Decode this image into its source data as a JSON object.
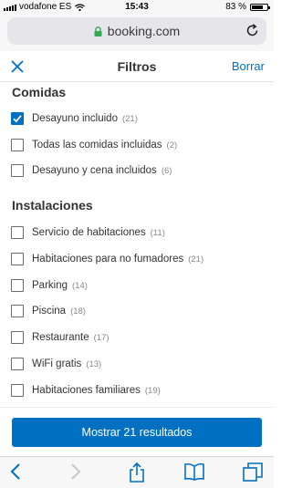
{
  "status_bar": {
    "carrier": "vodafone ES",
    "time": "15:43",
    "battery": "83 %",
    "battery_level": 0.83
  },
  "browser": {
    "url": "booking.com",
    "lock_icon": "lock-icon",
    "reload_icon": "reload-icon"
  },
  "header": {
    "title": "Filtros",
    "clear_label": "Borrar",
    "close_icon": "close-icon"
  },
  "sections": {
    "comidas": {
      "title": "Comidas",
      "options": [
        {
          "label": "Desayuno incluido",
          "count": "(21)",
          "checked": true
        },
        {
          "label": "Todas las comidas incluidas",
          "count": "(2)",
          "checked": false
        },
        {
          "label": "Desayuno y cena incluidos",
          "count": "(6)",
          "checked": false
        }
      ]
    },
    "instalaciones": {
      "title": "Instalaciones",
      "options": [
        {
          "label": "Servicio de habitaciones",
          "count": "(11)",
          "checked": false
        },
        {
          "label": "Habitaciones para no fumadores",
          "count": "(21)",
          "checked": false
        },
        {
          "label": "Parking",
          "count": "(14)",
          "checked": false
        },
        {
          "label": "Piscina",
          "count": "(18)",
          "checked": false
        },
        {
          "label": "Restaurante",
          "count": "(17)",
          "checked": false
        },
        {
          "label": "WiFi gratis",
          "count": "(13)",
          "checked": false
        },
        {
          "label": "Habitaciones familiares",
          "count": "(19)",
          "checked": false
        }
      ]
    }
  },
  "action": {
    "show_results_label": "Mostrar 21 resultados"
  },
  "colors": {
    "accent": "#0071c2",
    "url_lock": "#34a853"
  },
  "toolbar": {
    "icons": [
      "back-icon",
      "forward-icon",
      "share-icon",
      "bookmarks-icon",
      "tabs-icon"
    ]
  }
}
